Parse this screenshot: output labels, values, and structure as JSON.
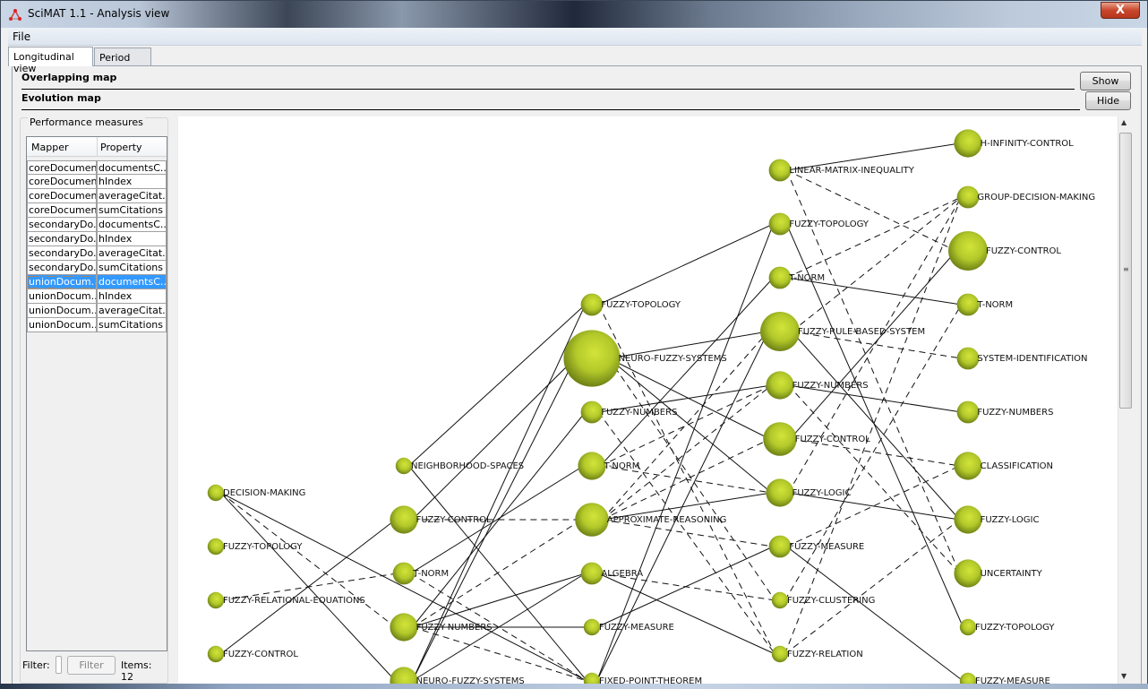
{
  "window": {
    "title": "SciMAT 1.1 - Analysis view",
    "close_label": "X"
  },
  "menu": {
    "items": [
      "File"
    ]
  },
  "tabs": [
    {
      "label": "Longitudinal view",
      "active": true
    },
    {
      "label": "Period view",
      "active": false
    }
  ],
  "maps": {
    "overlapping": {
      "title": "Overlapping map",
      "button": "Show"
    },
    "evolution": {
      "title": "Evolution map",
      "button": "Hide"
    }
  },
  "performance": {
    "title": "Performance measures",
    "columns": [
      "Mapper",
      "Property"
    ],
    "rows": [
      {
        "mapper": "coreDocuments",
        "property": "documentsC...",
        "selected": false
      },
      {
        "mapper": "coreDocuments",
        "property": "hIndex",
        "selected": false
      },
      {
        "mapper": "coreDocuments",
        "property": "averageCitat...",
        "selected": false
      },
      {
        "mapper": "coreDocuments",
        "property": "sumCitations",
        "selected": false
      },
      {
        "mapper": "secondaryDo...",
        "property": "documentsC...",
        "selected": false
      },
      {
        "mapper": "secondaryDo...",
        "property": "hIndex",
        "selected": false
      },
      {
        "mapper": "secondaryDo...",
        "property": "averageCitat...",
        "selected": false
      },
      {
        "mapper": "secondaryDo...",
        "property": "sumCitations",
        "selected": false
      },
      {
        "mapper": "unionDocum...",
        "property": "documentsC...",
        "selected": true
      },
      {
        "mapper": "unionDocum...",
        "property": "hIndex",
        "selected": false
      },
      {
        "mapper": "unionDocum...",
        "property": "averageCitat...",
        "selected": false
      },
      {
        "mapper": "unionDocum...",
        "property": "sumCitations",
        "selected": false
      }
    ],
    "filter_label": "Filter:",
    "filter_value": "",
    "filter_button": "Filter",
    "items_label": "Items:",
    "items_count": "12"
  },
  "evolution_map": {
    "node_color": "#b5cc2a",
    "periods": [
      {
        "nodes": [
          {
            "id": "p1-decision-making",
            "label": "DECISION-MAKING",
            "size": 1
          },
          {
            "id": "p1-fuzzy-topology",
            "label": "FUZZY-TOPOLOGY",
            "size": 1
          },
          {
            "id": "p1-fuzzy-relational-equations",
            "label": "FUZZY-RELATIONAL-EQUATIONS",
            "size": 1
          },
          {
            "id": "p1-fuzzy-control",
            "label": "FUZZY-CONTROL",
            "size": 1
          }
        ]
      },
      {
        "nodes": [
          {
            "id": "p2-neighborhood-spaces",
            "label": "NEIGHBORHOOD-SPACES",
            "size": 1
          },
          {
            "id": "p2-fuzzy-control",
            "label": "FUZZY-CONTROL",
            "size": 3
          },
          {
            "id": "p2-t-norm",
            "label": "T-NORM",
            "size": 2
          },
          {
            "id": "p2-fuzzy-numbers",
            "label": "FUZZY-NUMBERS",
            "size": 3
          },
          {
            "id": "p2-neuro-fuzzy-systems",
            "label": "NEURO-FUZZY-SYSTEMS",
            "size": 3
          }
        ]
      },
      {
        "nodes": [
          {
            "id": "p3-fuzzy-topology",
            "label": "FUZZY-TOPOLOGY",
            "size": 2
          },
          {
            "id": "p3-neuro-fuzzy-systems",
            "label": "NEURO-FUZZY-SYSTEMS",
            "size": 8
          },
          {
            "id": "p3-fuzzy-numbers",
            "label": "FUZZY-NUMBERS",
            "size": 2
          },
          {
            "id": "p3-t-norm",
            "label": "T-NORM",
            "size": 3
          },
          {
            "id": "p3-approximate-reasoning",
            "label": "APPROXIMATE-REASONING",
            "size": 4
          },
          {
            "id": "p3-algebra",
            "label": "ALGEBRA",
            "size": 2
          },
          {
            "id": "p3-fuzzy-measure",
            "label": "FUZZY-MEASURE",
            "size": 1
          },
          {
            "id": "p3-fixed-point-theorem",
            "label": "FIXED-POINT-THEOREM",
            "size": 1
          }
        ]
      },
      {
        "nodes": [
          {
            "id": "p4-linear-matrix-inequality",
            "label": "LINEAR-MATRIX-INEQUALITY",
            "size": 2
          },
          {
            "id": "p4-fuzzy-topology",
            "label": "FUZZY-TOPOLOGY",
            "size": 2
          },
          {
            "id": "p4-t-norm",
            "label": "T-NORM",
            "size": 2
          },
          {
            "id": "p4-fuzzy-rule-based-system",
            "label": "FUZZY-RULE-BASED-SYSTEM",
            "size": 5
          },
          {
            "id": "p4-fuzzy-numbers",
            "label": "FUZZY-NUMBERS",
            "size": 3
          },
          {
            "id": "p4-fuzzy-control",
            "label": "FUZZY-CONTROL",
            "size": 4
          },
          {
            "id": "p4-fuzzy-logic",
            "label": "FUZZY-LOGIC",
            "size": 3
          },
          {
            "id": "p4-fuzzy-measure",
            "label": "FUZZY-MEASURE",
            "size": 2
          },
          {
            "id": "p4-fuzzy-clustering",
            "label": "FUZZY-CLUSTERING",
            "size": 1
          },
          {
            "id": "p4-fuzzy-relation",
            "label": "FUZZY-RELATION",
            "size": 1
          }
        ]
      },
      {
        "nodes": [
          {
            "id": "p5-h-infinity-control",
            "label": "H-INFINITY-CONTROL",
            "size": 3
          },
          {
            "id": "p5-group-decision-making",
            "label": "GROUP-DECISION-MAKING",
            "size": 2
          },
          {
            "id": "p5-fuzzy-control",
            "label": "FUZZY-CONTROL",
            "size": 5
          },
          {
            "id": "p5-t-norm",
            "label": "T-NORM",
            "size": 2
          },
          {
            "id": "p5-system-identification",
            "label": "SYSTEM-IDENTIFICATION",
            "size": 2
          },
          {
            "id": "p5-fuzzy-numbers",
            "label": "FUZZY-NUMBERS",
            "size": 2
          },
          {
            "id": "p5-classification",
            "label": "CLASSIFICATION",
            "size": 3
          },
          {
            "id": "p5-fuzzy-logic",
            "label": "FUZZY-LOGIC",
            "size": 3
          },
          {
            "id": "p5-uncertainty",
            "label": "UNCERTAINTY",
            "size": 3
          },
          {
            "id": "p5-fuzzy-topology",
            "label": "FUZZY-TOPOLOGY",
            "size": 1
          },
          {
            "id": "p5-fuzzy-measure",
            "label": "FUZZY-MEASURE",
            "size": 1
          }
        ]
      }
    ],
    "edges": [
      [
        "p1-decision-making",
        "p2-fuzzy-numbers",
        "dashed"
      ],
      [
        "p1-decision-making",
        "p2-neuro-fuzzy-systems",
        "solid"
      ],
      [
        "p1-decision-making",
        "p3-fixed-point-theorem",
        "solid"
      ],
      [
        "p1-fuzzy-control",
        "p2-fuzzy-control",
        "solid"
      ],
      [
        "p1-fuzzy-relational-equations",
        "p2-t-norm",
        "dashed"
      ],
      [
        "p2-neighborhood-spaces",
        "p3-fuzzy-topology",
        "solid"
      ],
      [
        "p2-neighborhood-spaces",
        "p3-fixed-point-theorem",
        "solid"
      ],
      [
        "p2-fuzzy-control",
        "p3-approximate-reasoning",
        "dashed"
      ],
      [
        "p2-fuzzy-control",
        "p3-neuro-fuzzy-systems",
        "solid"
      ],
      [
        "p2-t-norm",
        "p3-t-norm",
        "solid"
      ],
      [
        "p2-t-norm",
        "p3-fixed-point-theorem",
        "dashed"
      ],
      [
        "p2-fuzzy-numbers",
        "p3-fuzzy-numbers",
        "solid"
      ],
      [
        "p2-fuzzy-numbers",
        "p3-fuzzy-measure",
        "solid"
      ],
      [
        "p2-fuzzy-numbers",
        "p3-algebra",
        "solid"
      ],
      [
        "p2-fuzzy-numbers",
        "p3-approximate-reasoning",
        "dashed"
      ],
      [
        "p2-fuzzy-numbers",
        "p3-fixed-point-theorem",
        "dashed"
      ],
      [
        "p2-neuro-fuzzy-systems",
        "p3-neuro-fuzzy-systems",
        "solid"
      ],
      [
        "p2-neuro-fuzzy-systems",
        "p3-fuzzy-topology",
        "solid"
      ],
      [
        "p2-neuro-fuzzy-systems",
        "p3-algebra",
        "solid"
      ],
      [
        "p3-fuzzy-topology",
        "p4-fuzzy-topology",
        "solid"
      ],
      [
        "p3-fuzzy-topology",
        "p4-fuzzy-relation",
        "dashed"
      ],
      [
        "p3-neuro-fuzzy-systems",
        "p4-fuzzy-rule-based-system",
        "solid"
      ],
      [
        "p3-neuro-fuzzy-systems",
        "p4-fuzzy-control",
        "solid"
      ],
      [
        "p3-neuro-fuzzy-systems",
        "p4-fuzzy-logic",
        "solid"
      ],
      [
        "p3-neuro-fuzzy-systems",
        "p4-fuzzy-clustering",
        "dashed"
      ],
      [
        "p3-fuzzy-numbers",
        "p4-fuzzy-numbers",
        "solid"
      ],
      [
        "p3-fuzzy-numbers",
        "p4-fuzzy-relation",
        "dashed"
      ],
      [
        "p3-t-norm",
        "p4-t-norm",
        "solid"
      ],
      [
        "p3-t-norm",
        "p4-fuzzy-logic",
        "dashed"
      ],
      [
        "p3-t-norm",
        "p4-fuzzy-numbers",
        "dashed"
      ],
      [
        "p3-approximate-reasoning",
        "p4-fuzzy-logic",
        "solid"
      ],
      [
        "p3-approximate-reasoning",
        "p4-fuzzy-rule-based-system",
        "dashed"
      ],
      [
        "p3-approximate-reasoning",
        "p4-fuzzy-control",
        "dashed"
      ],
      [
        "p3-approximate-reasoning",
        "p4-fuzzy-measure",
        "dashed"
      ],
      [
        "p3-approximate-reasoning",
        "p4-fuzzy-numbers",
        "dashed"
      ],
      [
        "p3-algebra",
        "p4-fuzzy-relation",
        "solid"
      ],
      [
        "p3-algebra",
        "p4-fuzzy-clustering",
        "dashed"
      ],
      [
        "p3-fuzzy-measure",
        "p4-fuzzy-measure",
        "solid"
      ],
      [
        "p3-fixed-point-theorem",
        "p4-fuzzy-topology",
        "solid"
      ],
      [
        "p3-fixed-point-theorem",
        "p4-fuzzy-rule-based-system",
        "solid"
      ],
      [
        "p4-linear-matrix-inequality",
        "p5-h-infinity-control",
        "solid"
      ],
      [
        "p4-linear-matrix-inequality",
        "p5-fuzzy-control",
        "dashed"
      ],
      [
        "p4-linear-matrix-inequality",
        "p5-uncertainty",
        "dashed"
      ],
      [
        "p4-fuzzy-topology",
        "p5-fuzzy-topology",
        "solid"
      ],
      [
        "p4-t-norm",
        "p5-t-norm",
        "solid"
      ],
      [
        "p4-t-norm",
        "p5-group-decision-making",
        "dashed"
      ],
      [
        "p4-fuzzy-rule-based-system",
        "p5-group-decision-making",
        "dashed"
      ],
      [
        "p4-fuzzy-rule-based-system",
        "p5-system-identification",
        "dashed"
      ],
      [
        "p4-fuzzy-rule-based-system",
        "p5-fuzzy-logic",
        "solid"
      ],
      [
        "p4-fuzzy-numbers",
        "p5-fuzzy-numbers",
        "solid"
      ],
      [
        "p4-fuzzy-numbers",
        "p5-uncertainty",
        "dashed"
      ],
      [
        "p4-fuzzy-control",
        "p5-fuzzy-control",
        "solid"
      ],
      [
        "p4-fuzzy-control",
        "p5-classification",
        "dashed"
      ],
      [
        "p4-fuzzy-logic",
        "p5-fuzzy-logic",
        "solid"
      ],
      [
        "p4-fuzzy-logic",
        "p5-group-decision-making",
        "dashed"
      ],
      [
        "p4-fuzzy-measure",
        "p5-fuzzy-measure",
        "solid"
      ],
      [
        "p4-fuzzy-measure",
        "p5-classification",
        "dashed"
      ],
      [
        "p4-fuzzy-clustering",
        "p5-t-norm",
        "dashed"
      ],
      [
        "p4-fuzzy-relation",
        "p5-fuzzy-logic",
        "dashed"
      ],
      [
        "p4-fuzzy-relation",
        "p5-group-decision-making",
        "dashed"
      ]
    ]
  }
}
